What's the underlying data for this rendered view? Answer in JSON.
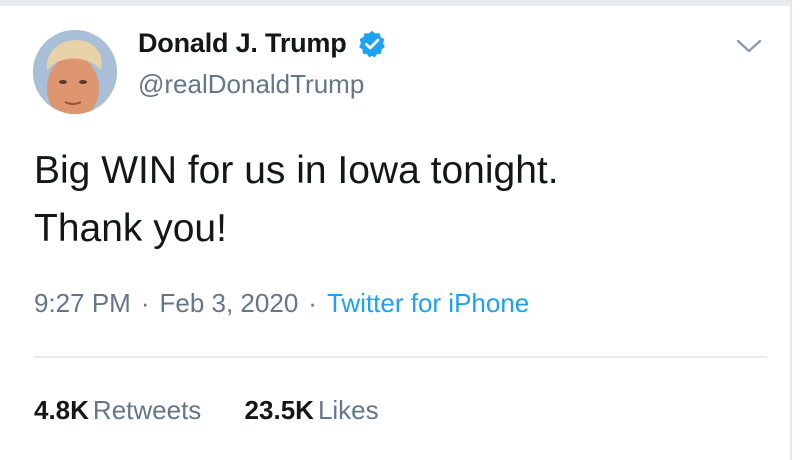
{
  "tweet": {
    "author": {
      "display_name": "Donald J. Trump",
      "handle": "@realDonaldTrump",
      "verified": true,
      "avatar_icon": "profile-photo"
    },
    "text_line1": "Big WIN for us in Iowa tonight.",
    "text_line2": "Thank you!",
    "time": "9:27 PM",
    "date": "Feb 3, 2020",
    "separator": "·",
    "source": "Twitter for iPhone",
    "stats": {
      "retweets_count": "4.8K",
      "retweets_label": "Retweets",
      "likes_count": "23.5K",
      "likes_label": "Likes"
    },
    "menu_icon": "chevron-down-icon"
  },
  "colors": {
    "text": "#14171a",
    "secondary": "#657786",
    "accent": "#1da1f2",
    "divider": "#e6ecf0"
  }
}
